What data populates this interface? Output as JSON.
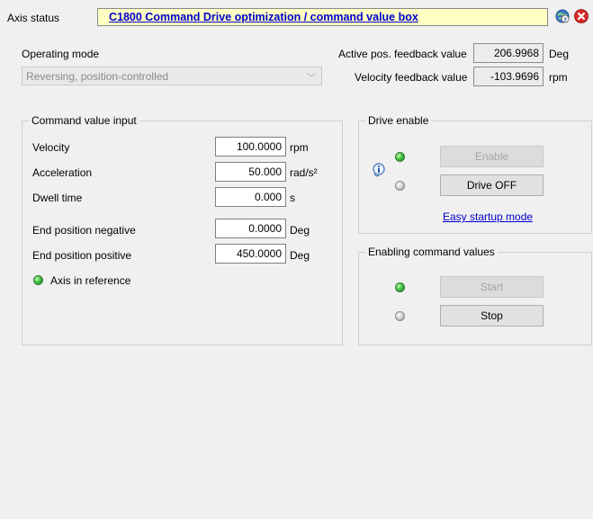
{
  "header": {
    "axis_status_label": "Axis status",
    "axis_status_value": "C1800 Command Drive optimization / command value box",
    "help_icon": "help-globe-icon",
    "close_icon": "close-icon"
  },
  "operating_mode": {
    "label": "Operating mode",
    "selected": "Reversing, position-controlled"
  },
  "feedback": {
    "active_pos_label": "Active pos. feedback value",
    "active_pos_value": "206.9968",
    "active_pos_unit": "Deg",
    "velocity_label": "Velocity feedback value",
    "velocity_value": "-103.9696",
    "velocity_unit": "rpm"
  },
  "command_input": {
    "title": "Command value input",
    "velocity_label": "Velocity",
    "velocity_value": "100.0000",
    "velocity_unit": "rpm",
    "accel_label": "Acceleration",
    "accel_value": "50.000",
    "accel_unit": "rad/s²",
    "dwell_label": "Dwell time",
    "dwell_value": "0.000",
    "dwell_unit": "s",
    "endneg_label": "End position negative",
    "endneg_value": "0.0000",
    "endneg_unit": "Deg",
    "endpos_label": "End position positive",
    "endpos_value": "450.0000",
    "endpos_unit": "Deg",
    "axis_ref_label": "Axis in reference"
  },
  "drive_enable": {
    "title": "Drive enable",
    "enable_button": "Enable",
    "drive_off_button": "Drive OFF",
    "easy_startup_link": "Easy startup mode",
    "info_icon": "info-icon"
  },
  "enabling": {
    "title": "Enabling command values",
    "start_button": "Start",
    "stop_button": "Stop"
  },
  "colors": {
    "accent_link": "#0000cc",
    "status_bg": "#ffffc4",
    "led_green": "#3fbf3f",
    "led_gray": "#cfcfcf"
  }
}
